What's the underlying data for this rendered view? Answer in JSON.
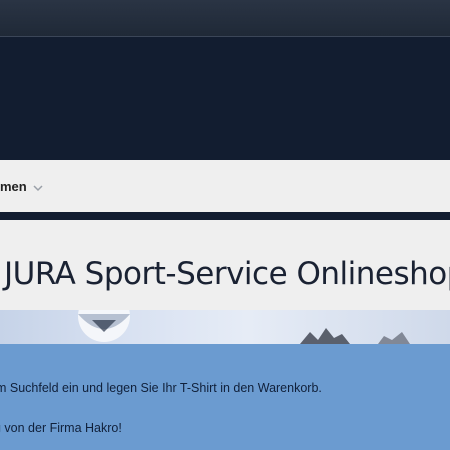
{
  "nav": {
    "item_label": "nmen",
    "chevron_icon": "chevron-down-icon"
  },
  "page": {
    "title": "JURA Sport-Service Onlineshop"
  },
  "info": {
    "line1": "m Suchfeld ein und legen Sie Ihr T-Shirt in den Warenkorb.",
    "line2": "g von der Firma Hakro!"
  },
  "colors": {
    "header_bg": "#121d30",
    "nav_bg": "#efefef",
    "info_bg": "#6b9bd0"
  }
}
